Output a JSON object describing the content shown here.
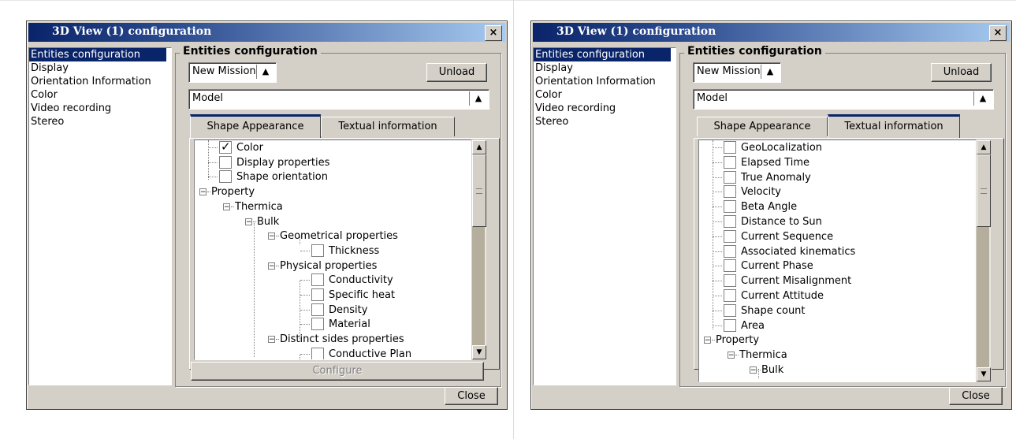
{
  "dialogs": [
    {
      "title": "3D View (1) configuration",
      "close_glyph": "×",
      "sidebar": [
        "Entities configuration",
        "Display",
        "Orientation Information",
        "Color",
        "Video recording",
        "Stereo"
      ],
      "selected_sidebar_index": 0,
      "group_title": "Entities configuration",
      "mission_combo": "New Mission",
      "unload_label": "Unload",
      "model_combo": "Model",
      "tabs": [
        "Shape Appearance",
        "Textual information"
      ],
      "active_tab": 0,
      "configure_label": "Configure",
      "close_label": "Close",
      "tree": [
        {
          "label": "Color",
          "checked": true
        },
        {
          "label": "Display properties",
          "checked": false
        },
        {
          "label": "Shape orientation",
          "checked": false
        },
        {
          "label": "Property"
        },
        {
          "label": "Thermica"
        },
        {
          "label": "Bulk"
        },
        {
          "label": "Geometrical properties"
        },
        {
          "label": "Thickness",
          "checked": false
        },
        {
          "label": "Physical properties"
        },
        {
          "label": "Conductivity",
          "checked": false
        },
        {
          "label": "Specific heat",
          "checked": false
        },
        {
          "label": "Density",
          "checked": false
        },
        {
          "label": "Material",
          "checked": false
        },
        {
          "label": "Distinct sides properties"
        },
        {
          "label": "Conductive Plan",
          "checked": false
        }
      ]
    },
    {
      "title": "3D View (1) configuration",
      "close_glyph": "×",
      "sidebar": [
        "Entities configuration",
        "Display",
        "Orientation Information",
        "Color",
        "Video recording",
        "Stereo"
      ],
      "selected_sidebar_index": 0,
      "group_title": "Entities configuration",
      "mission_combo": "New Mission",
      "unload_label": "Unload",
      "model_combo": "Model",
      "tabs": [
        "Shape Appearance",
        "Textual information"
      ],
      "active_tab": 1,
      "close_label": "Close",
      "tree": [
        {
          "label": "GeoLocalization",
          "checked": false
        },
        {
          "label": "Elapsed Time",
          "checked": false
        },
        {
          "label": "True Anomaly",
          "checked": false
        },
        {
          "label": "Velocity",
          "checked": false
        },
        {
          "label": "Beta Angle",
          "checked": false
        },
        {
          "label": "Distance to Sun",
          "checked": false
        },
        {
          "label": "Current Sequence",
          "checked": false
        },
        {
          "label": "Associated kinematics",
          "checked": false
        },
        {
          "label": "Current Phase",
          "checked": false
        },
        {
          "label": "Current Misalignment",
          "checked": false
        },
        {
          "label": "Current Attitude",
          "checked": false
        },
        {
          "label": "Shape count",
          "checked": false
        },
        {
          "label": "Area",
          "checked": false
        },
        {
          "label": "Property"
        },
        {
          "label": "Thermica"
        },
        {
          "label": "Bulk"
        }
      ]
    }
  ]
}
